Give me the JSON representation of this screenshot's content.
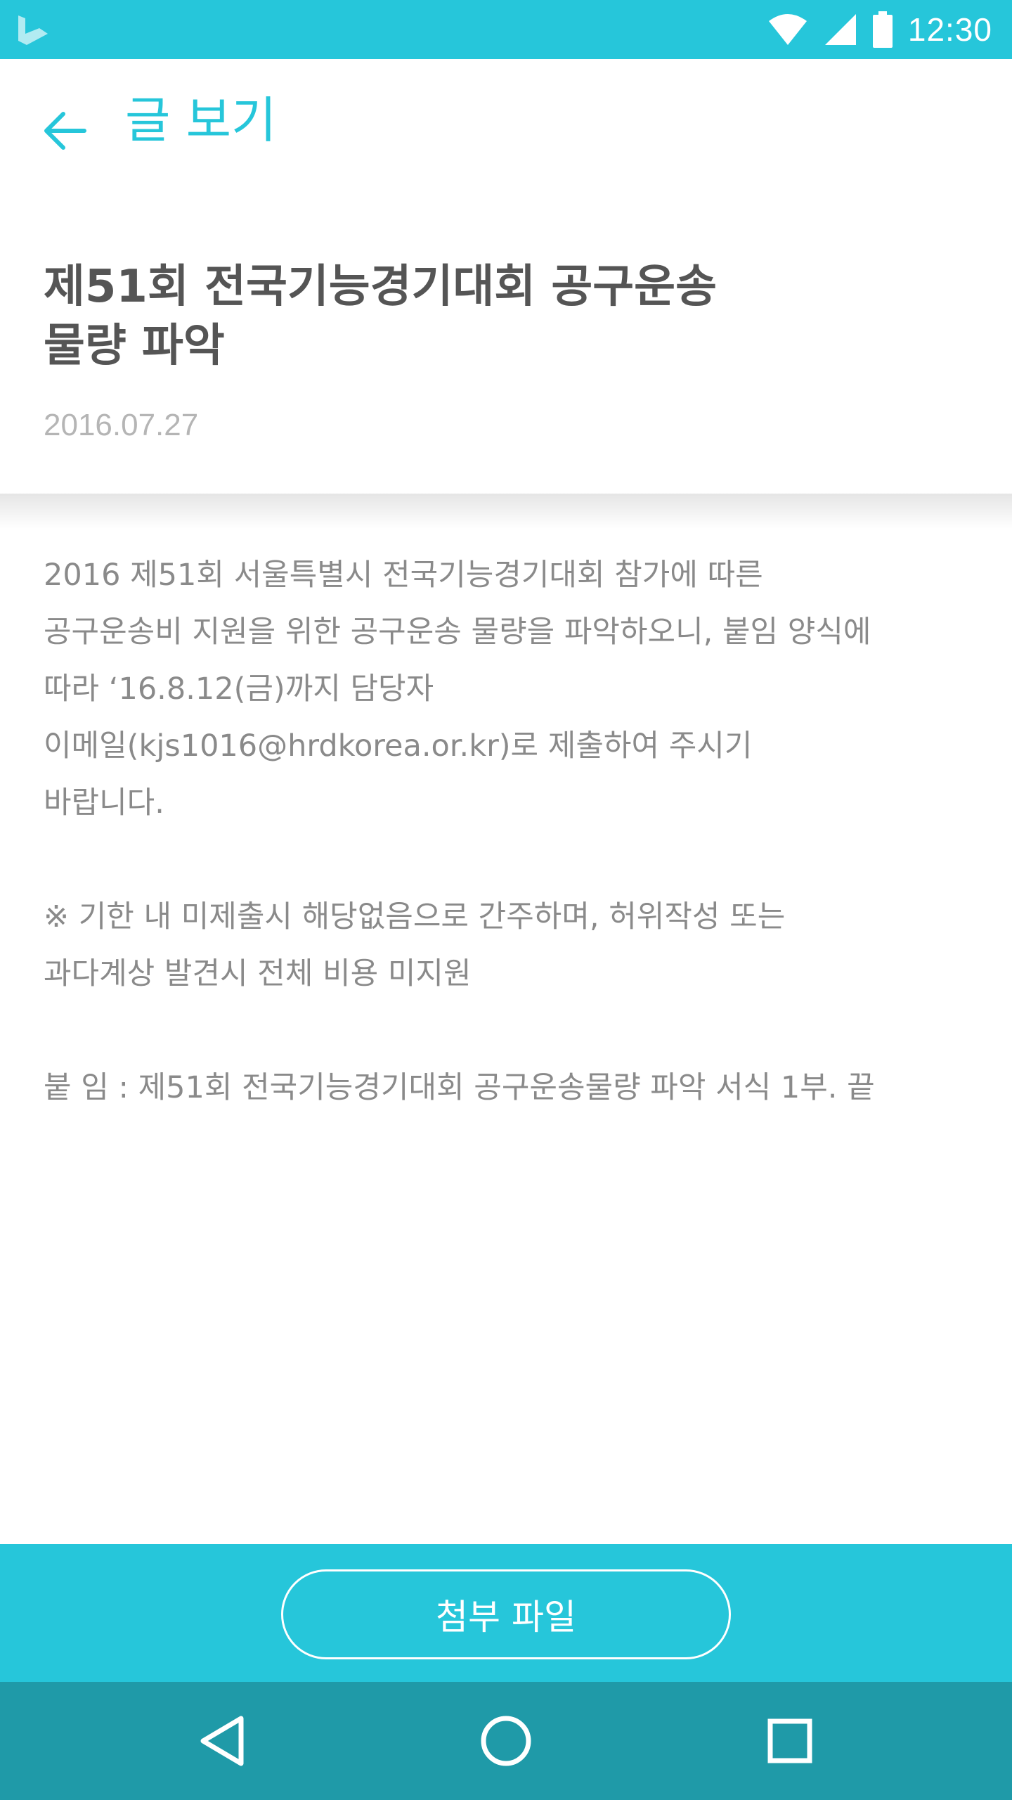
{
  "status_bar": {
    "time": "12:30",
    "icons": [
      "app-logo-icon",
      "wifi-icon",
      "cell-signal-icon",
      "battery-icon"
    ]
  },
  "app_bar": {
    "back_icon": "arrow-left-icon",
    "title": "글 보기"
  },
  "post": {
    "title_line1": "제51회 전국기능경기대회 공구운송",
    "title_line2": "물량 파악",
    "date": "2016.07.27",
    "body_lines": [
      "2016 제51회 서울특별시 전국기능경기대회 참가에 따른",
      "공구운송비 지원을 위한 공구운송 물량을 파악하오니, 붙임 양식에",
      "따라 ‘16.8.12(금)까지 담당자",
      "이메일(kjs1016@hrdkorea.or.kr)로 제출하여 주시기",
      "바랍니다."
    ],
    "notice_lines": [
      "※ 기한 내 미제출시 해당없음으로 간주하며, 허위작성 또는",
      "과다계상 발견시 전체 비용 미지원"
    ],
    "attachment_line": "붙 임 : 제51회 전국기능경기대회 공구운송물량 파악 서식 1부. 끝"
  },
  "attach_bar": {
    "button_label": "첨부 파일"
  },
  "nav_bar": {
    "icons": [
      "back-triangle-icon",
      "home-circle-icon",
      "recents-square-icon"
    ]
  },
  "colors": {
    "accent": "#26c6da",
    "nav_bar": "#1f9aa8",
    "title_text": "#555555",
    "body_text": "#8a8a8a",
    "date_text": "#b5b5b5"
  }
}
